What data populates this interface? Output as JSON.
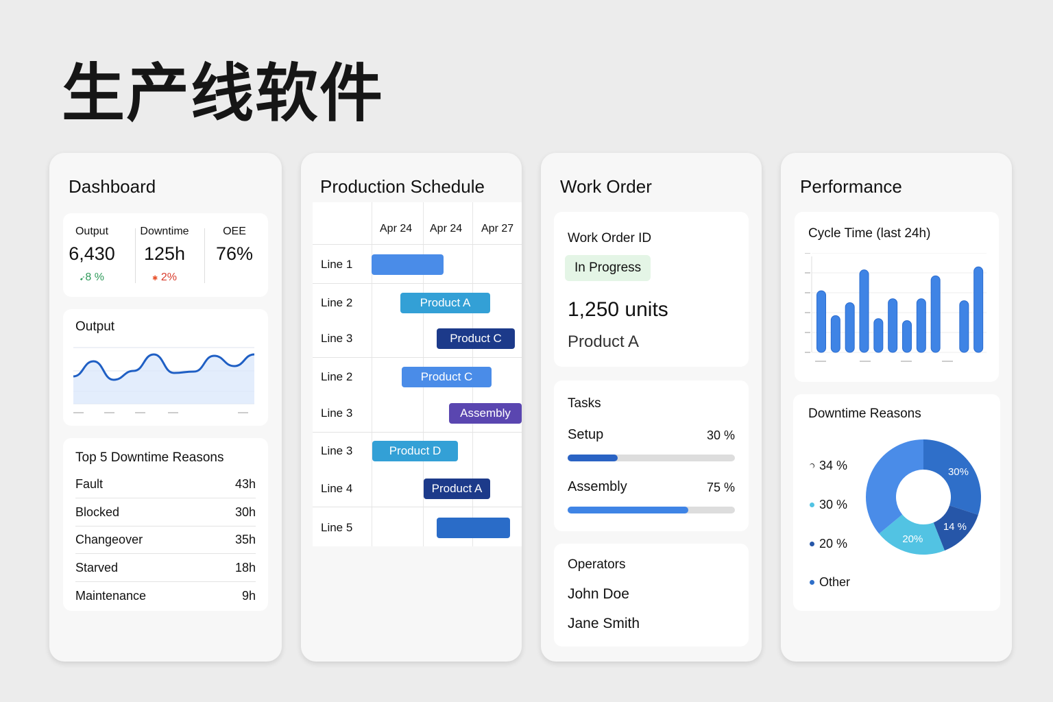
{
  "title": "生产线软件",
  "dashboard": {
    "title": "Dashboard",
    "kpis": [
      {
        "label": "Output",
        "value": "6,430",
        "delta": "8 %",
        "delta_color": "#2e9a5a"
      },
      {
        "label": "Downtime",
        "value": "125h",
        "delta": "2%",
        "delta_color": "#d83a2a"
      },
      {
        "label": "OEE",
        "value": "76%"
      }
    ],
    "output_chart_title": "Output",
    "output_series": [
      40,
      62,
      35,
      48,
      72,
      45,
      47,
      70,
      55,
      72
    ],
    "downtime_title": "Top 5 Downtime Reasons",
    "downtime": [
      {
        "label": "Fault",
        "value": "43h"
      },
      {
        "label": "Blocked",
        "value": "30h"
      },
      {
        "label": "Changeover",
        "value": "35h"
      },
      {
        "label": "Starved",
        "value": "18h"
      },
      {
        "label": "Maintenance",
        "value": "9h"
      }
    ]
  },
  "schedule": {
    "title": "Production Schedule",
    "dates": [
      "Apr 24",
      "Apr 24",
      "Apr 27"
    ],
    "rows": [
      {
        "line": "Line 1",
        "bar": ""
      },
      {
        "line": "Line 2",
        "bar": "Product A"
      },
      {
        "line": "Line 3",
        "bar": "Product C"
      },
      {
        "line": "Line 2",
        "bar": "Product C"
      },
      {
        "line": "Line 3",
        "bar": "Assembly"
      },
      {
        "line": "Line 3",
        "bar": "Product D"
      },
      {
        "line": "Line 4",
        "bar": "Product A"
      },
      {
        "line": "Line 5",
        "bar": ""
      }
    ]
  },
  "work_order": {
    "title": "Work Order",
    "id_label": "Work Order ID",
    "status": "In Progress",
    "quantity": "1,250 units",
    "product": "Product A",
    "tasks_title": "Tasks",
    "tasks": [
      {
        "label": "Setup",
        "percent_text": "30 %",
        "progress": 30
      },
      {
        "label": "Assembly",
        "percent_text": "75 %",
        "progress": 72
      }
    ],
    "operators_title": "Operators",
    "operators": [
      "John Doe",
      "Jane Smith"
    ]
  },
  "performance": {
    "title": "Performance",
    "cycle_title": "Cycle Time (last 24h)",
    "cycle_values": [
      62,
      37,
      50,
      83,
      34,
      54,
      32,
      54,
      77,
      null,
      52,
      86
    ],
    "downtime_title": "Downtime Reasons",
    "legend": [
      "34 %",
      "30 %",
      "20 %",
      "Other"
    ],
    "donut": [
      {
        "label": "30%",
        "value": 30,
        "color": "#2f6fc9"
      },
      {
        "label": "14 %",
        "value": 14,
        "color": "#2656a8"
      },
      {
        "label": "20%",
        "value": 20,
        "color": "#52c3e3"
      },
      {
        "label": "",
        "value": 36,
        "color": "#4a8ce8"
      }
    ]
  }
}
